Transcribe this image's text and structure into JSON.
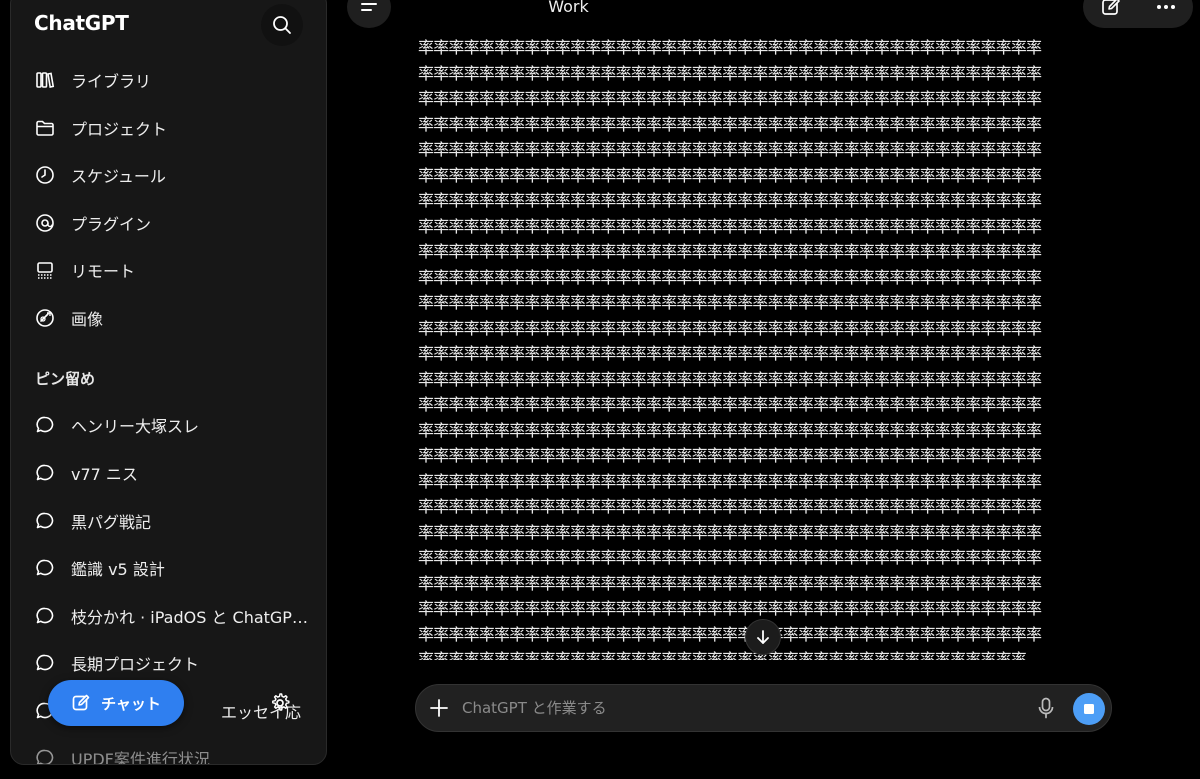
{
  "sidebar": {
    "app_title": "ChatGPT",
    "nav": [
      {
        "label": "ライブラリ",
        "icon": "library-icon"
      },
      {
        "label": "プロジェクト",
        "icon": "folder-icon"
      },
      {
        "label": "スケジュール",
        "icon": "clock-icon"
      },
      {
        "label": "プラグイン",
        "icon": "plugin-icon"
      },
      {
        "label": "リモート",
        "icon": "remote-icon"
      },
      {
        "label": "画像",
        "icon": "image-icon"
      }
    ],
    "pinned_heading": "ピン留め",
    "pinned": [
      {
        "label": "ヘンリー大塚スレ"
      },
      {
        "label": "v77 ニス"
      },
      {
        "label": "黒パグ戦記"
      },
      {
        "label": "鑑識 v5 設計"
      },
      {
        "label": "枝分かれ · iPadOS と ChatGP…"
      },
      {
        "label": "長期プロジェクト"
      },
      {
        "label": "エッセイ応"
      },
      {
        "label": "UPDF案件進行状況"
      }
    ],
    "chat_button": "チャット"
  },
  "header": {
    "title": "Work"
  },
  "message": {
    "char": "率",
    "lines": [
      "率率率率率率率率率率率率率率率率率率率率率率率率率率率率率率率率率率率率率率率率率",
      "率率率率率率率率率率率率率率率率率率率率率率率率率率率率率率率率率率率率率率率率率",
      "率率率率率率率率率率率率率率率率率率率率率率率率率率率率率率率率率率率率率率率率率",
      "率率率率率率率率率率率率率率率率率率率率率率率率率率率率率率率率率率率率率率率率率",
      "率率率率率率率率率率率率率率率率率率率率率率率率率率率率率率率率率率率率率率率率率",
      "率率率率率率率率率率率率率率率率率率率率率率率率率率率率率率率率率率率率率率率率率",
      "率率率率率率率率率率率率率率率率率率率率率率率率率率率率率率率率率率率率率率率率率",
      "率率率率率率率率率率率率率率率率率率率率率率率率率率率率率率率率率率率率率率率率率",
      "率率率率率率率率率率率率率率率率率率率率率率率率率率率率率率率率率率率率率率率率率",
      "率率率率率率率率率率率率率率率率率率率率率率率率率率率率率率率率率率率率率率率率率",
      "率率率率率率率率率率率率率率率率率率率率率率率率率率率率率率率率率率率率率率率率率",
      "率率率率率率率率率率率率率率率率率率率率率率率率率率率率率率率率率率率率率率率率率",
      "率率率率率率率率率率率率率率率率率率率率率率率率率率率率率率率率率率率率率率率率率",
      "率率率率率率率率率率率率率率率率率率率率率率率率率率率率率率率率率率率率率率率率率",
      "率率率率率率率率率率率率率率率率率率率率率率率率率率率率率率率率率率率率率率率率率",
      "率率率率率率率率率率率率率率率率率率率率率率率率率率率率率率率率率率率率率率率率率",
      "率率率率率率率率率率率率率率率率率率率率率率率率率率率率率率率率率率率率率率率率率",
      "率率率率率率率率率率率率率率率率率率率率率率率率率率率率率率率率率率率率率率率率率",
      "率率率率率率率率率率率率率率率率率率率率率率率率率率率率率率率率率率率率率率率率率",
      "率率率率率率率率率率率率率率率率率率率率率率率率率率率率率率率率率率率率率率率率率",
      "率率率率率率率率率率率率率率率率率率率率率率率率率率率率率率率率率率率率率率率率率",
      "率率率率率率率率率率率率率率率率率率率率率率率率率率率率率率率率率率率率率率率率率",
      "率率率率率率率率率率率率率率率率率率率率率率率率率率率率率率率率率率率率率率率率率",
      "率率率率率率率率率率率率率率率率率率率率率率率率率率率率率率率率率率率率率率率率率",
      "率率率率率率率率率率率率率率率率率率率率率率率率率率率率率率率率率率率率率率率率",
      "率率率率率率率率率率率率率率率率率率率率率率率率率率率率率率率率率率率率率率率",
      "率率率率率率率率率率率率率率率率率率率率率率率率率率率率率率率率率率率率率率率率率",
      "率率率率率率率率率率率率率率率率率率率率率率率率率率率率率率率率率率率率率率率率率"
    ]
  },
  "composer": {
    "placeholder": "ChatGPT と作業する"
  },
  "colors": {
    "accent": "#2f7ff0",
    "send": "#4d9ef6",
    "background": "#000000",
    "sidebar": "#171717"
  }
}
